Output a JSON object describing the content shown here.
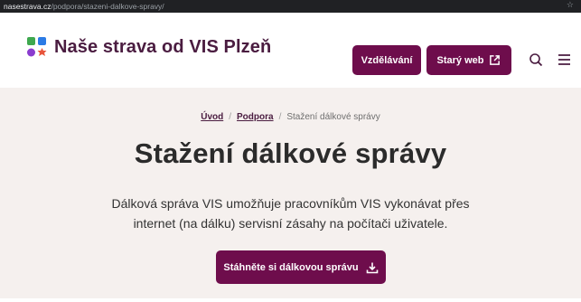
{
  "browser": {
    "url_domain": "nasestrava.cz",
    "url_path": "/podpora/stazeni-dalkove-spravy/",
    "star_icon": "star-icon"
  },
  "header": {
    "brand": "Naše strava od VIS Plzeň",
    "logo_colors": [
      "#3ea84f",
      "#2c7be5",
      "#e8553c",
      "#8a3ccf"
    ],
    "buttons": {
      "education": "Vzdělávání",
      "old_web": "Starý web"
    },
    "icons": [
      "search-icon",
      "menu-icon",
      "external-link-icon"
    ],
    "accent": "#6e0d4c"
  },
  "breadcrumb": {
    "home": "Úvod",
    "support": "Podpora",
    "current": "Stažení dálkové správy",
    "separator": "/"
  },
  "main": {
    "title": "Stažení dálkové správy",
    "description": "Dálková správa VIS umožňuje pracovníkům VIS vykonávat přes internet (na dálku) servisní zásahy na počítači uživatele.",
    "download_button": "Stáhněte si dálkovou správu",
    "download_icon": "download-icon",
    "background": "#f5f0ee"
  }
}
